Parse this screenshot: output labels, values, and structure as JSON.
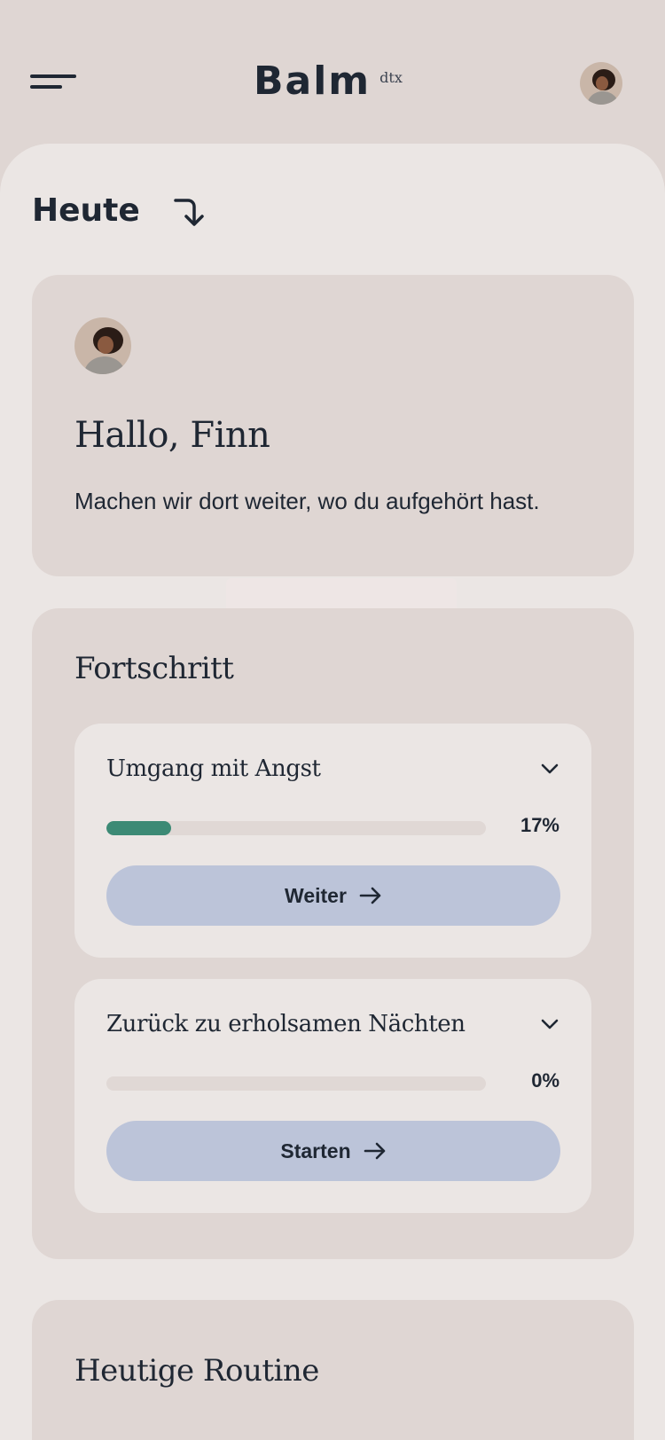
{
  "header": {
    "logo": "Balm",
    "logo_sup": "dtx"
  },
  "section": {
    "title": "Heute"
  },
  "greeting": {
    "title": "Hallo, Finn",
    "subtitle": "Machen wir dort weiter, wo du aufgehört hast."
  },
  "progress": {
    "title": "Fortschritt",
    "courses": [
      {
        "title": "Umgang mit Angst",
        "percent_label": "17%",
        "percent": 17,
        "button": "Weiter"
      },
      {
        "title": "Zurück zu erholsamen Nächten",
        "percent_label": "0%",
        "percent": 0,
        "button": "Starten"
      }
    ]
  },
  "routine": {
    "title": "Heutige Routine"
  },
  "colors": {
    "background": "#dfd6d3",
    "sheet": "#ebe6e4",
    "accent_progress": "#3c8a75",
    "button": "#bcc4d9",
    "text": "#1f2733"
  },
  "icons": {
    "menu": "menu-icon",
    "avatar": "avatar",
    "arrow_down_right": "arrow-turn-down-icon",
    "chevron": "chevron-down-icon",
    "arrow_right": "arrow-right-icon"
  }
}
